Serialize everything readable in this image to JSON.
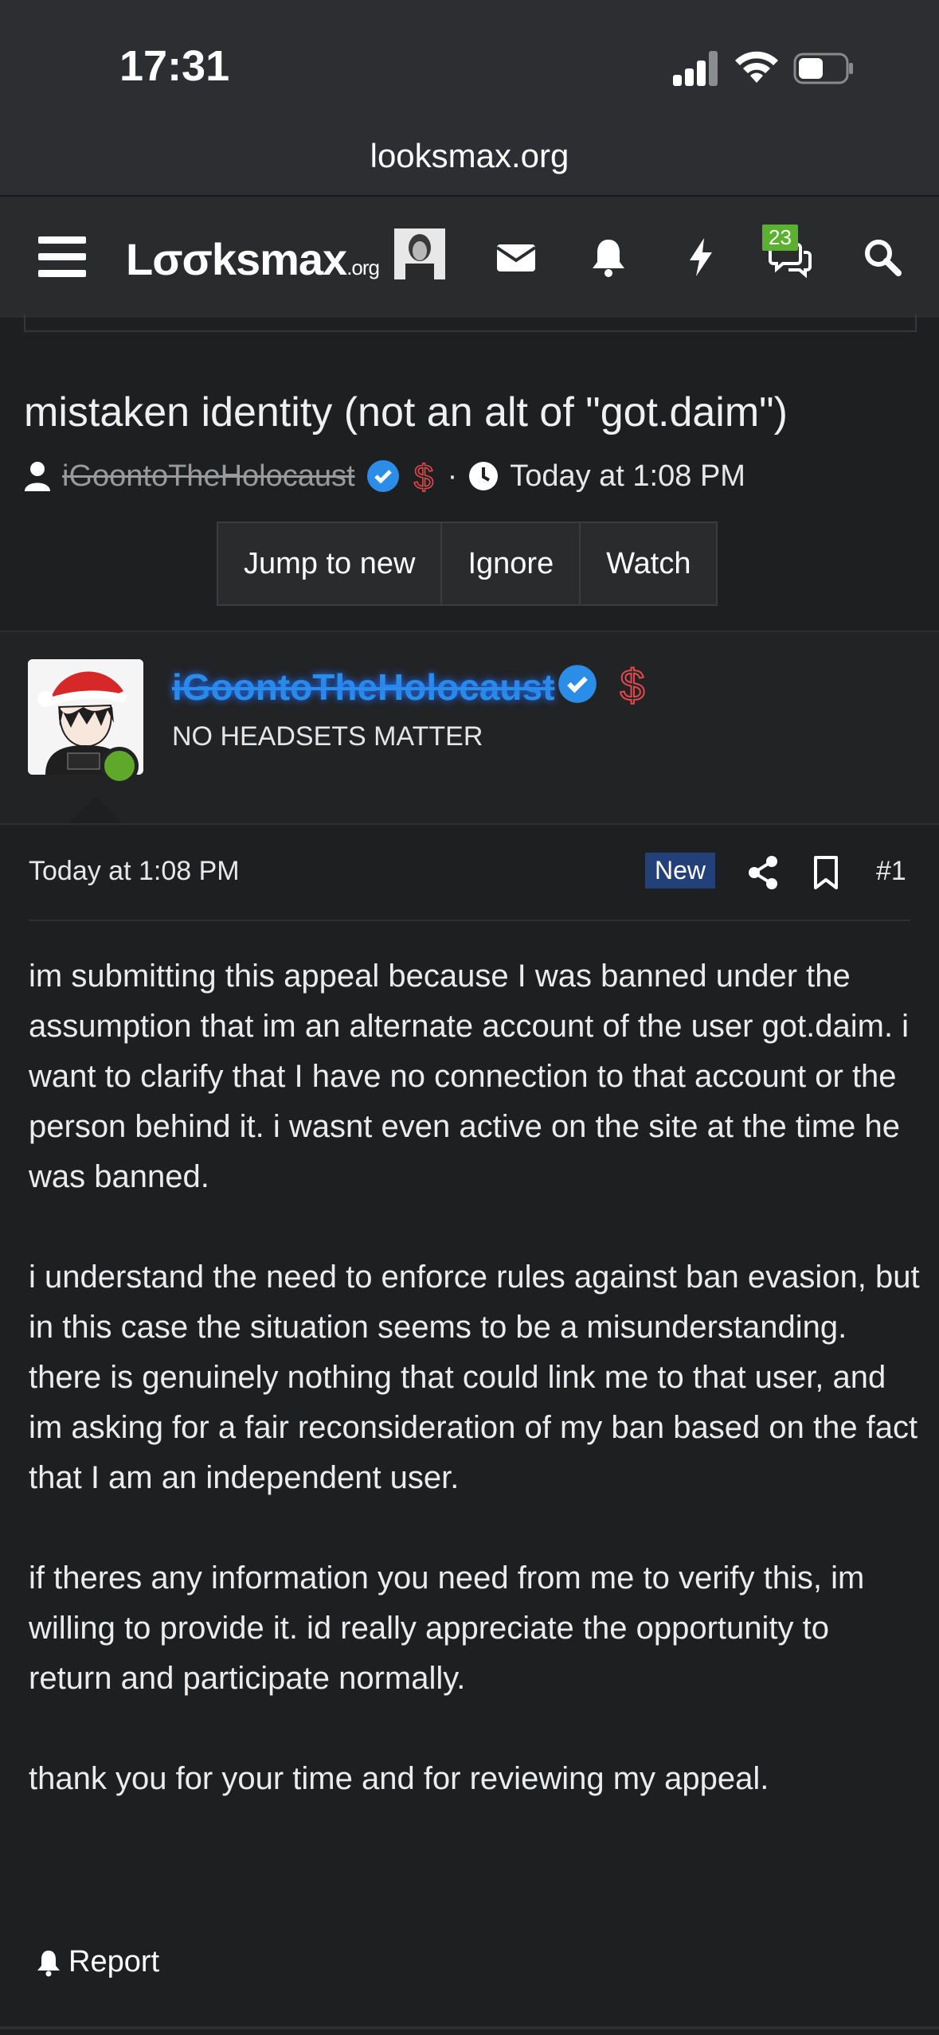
{
  "status_bar": {
    "time": "17:31"
  },
  "browser": {
    "url": "looksmax.org"
  },
  "nav": {
    "logo": "Lσσksmax",
    "logo_suffix": ".org",
    "conversations_badge": "23",
    "icons": [
      "menu-icon",
      "avatar",
      "mail-icon",
      "bell-icon",
      "lightning-icon",
      "chat-icon",
      "search-icon"
    ]
  },
  "thread": {
    "title": "mistaken identity (not an alt of \"got.daim\")",
    "author": "iGoontoTheHolocaust",
    "separator": "·",
    "date": "Today at 1:08 PM",
    "buttons": {
      "jump": "Jump to new",
      "ignore": "Ignore",
      "watch": "Watch"
    }
  },
  "post": {
    "username": "iGoontoTheHolocaust",
    "user_title": "NO HEADSETS MATTER",
    "date": "Today at 1:08 PM",
    "new_label": "New",
    "number": "#1",
    "paragraphs": [
      "im submitting this appeal because I was banned under the assumption that im an alternate account of the user got.daim. i want to clarify that I have no connection to that account or the person behind it. i wasnt even active on the site at the time he was banned.",
      "i understand the need to enforce rules against ban evasion, but in this case the situation seems to be a misunderstanding. there is genuinely nothing that could link me to that user, and im asking for a fair reconsideration of my ban based on the fact that I am an independent user.",
      "if theres any information you need from me to verify this, im willing to provide it. id really appreciate the opportunity to return and participate normally.",
      "thank you for your time and for reviewing my appeal."
    ],
    "report_label": "Report"
  },
  "colors": {
    "username": "#2b8de8",
    "new_badge": "#23407a",
    "online": "#5fa829",
    "chat_badge": "#5bb02f"
  }
}
